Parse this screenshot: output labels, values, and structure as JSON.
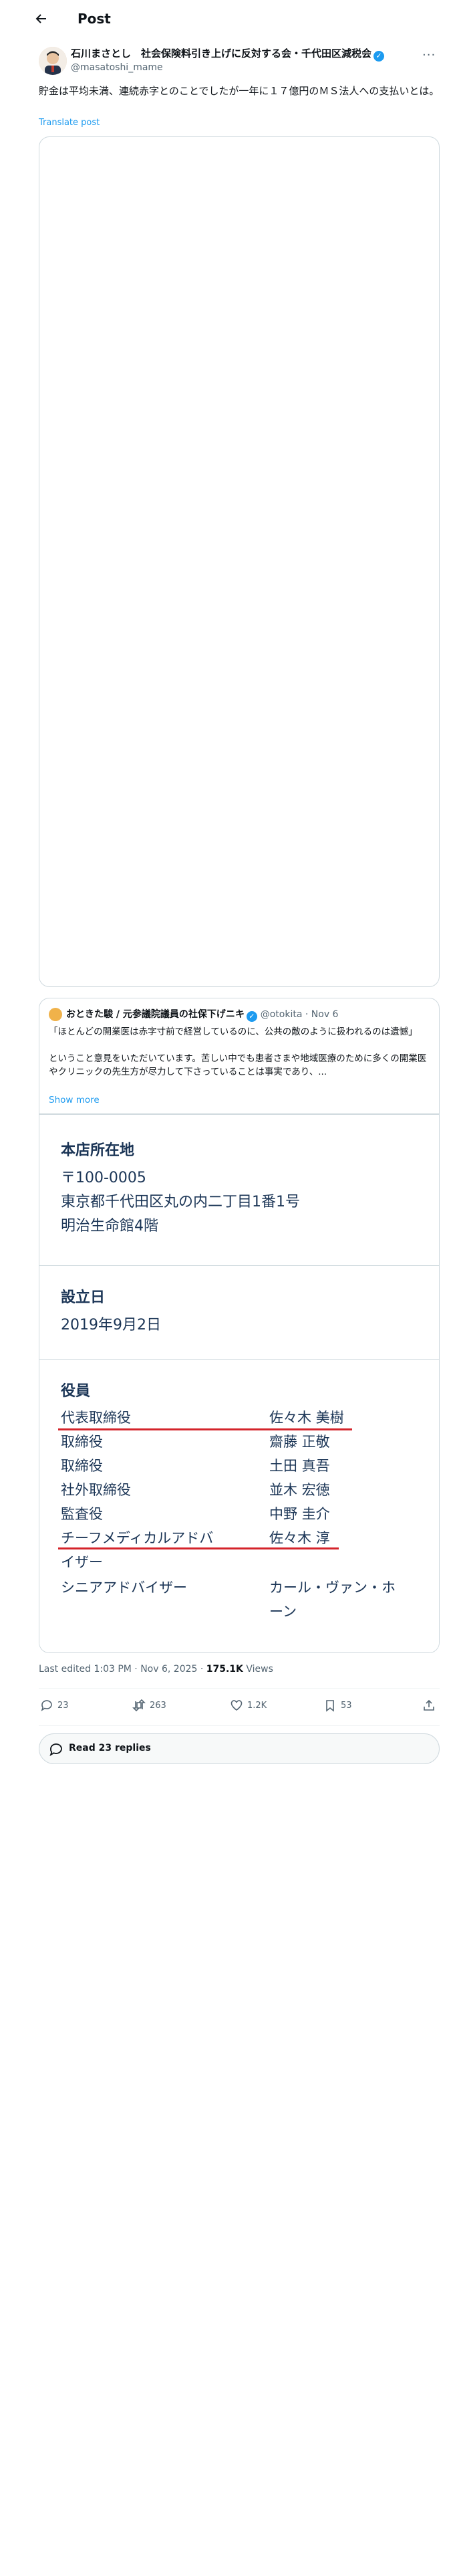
{
  "header": {
    "title": "Post"
  },
  "author": {
    "name": "石川まさとし　社会保険料引き上げに反対する会・千代田区減税会",
    "handle": "@masatoshi_mame"
  },
  "post": {
    "text": "貯金は平均未満、連続赤字とのことでしたが一年に１７億円のＭＳ法人への支払いとは。",
    "translate_label": "Translate post"
  },
  "quote": {
    "author_name": "おときた駿 / 元参議院議員の社保下げニキ",
    "author_handle": "@otokita · Nov 6",
    "text": "「ほとんどの開業医は赤字寸前で経営しているのに、公共の敵のように扱われるのは遺憾」\n\nということ意見をいただいています。苦しい中でも患者さまや地域医療のために多くの開業医やクリニックの先生方が尽力して下さっていることは事実であり、...",
    "show_more": "Show more",
    "image": {
      "address_heading": "本店所在地",
      "address": "〒100-0005\n東京都千代田区丸の内二丁目1番1号\n明治生命館4階",
      "founded_heading": "設立日",
      "founded": "2019年9月2日",
      "officers_heading": "役員",
      "officers": [
        {
          "role": "代表取締役",
          "name": "佐々木 美樹"
        },
        {
          "role": "取締役",
          "name": "齋藤 正敬"
        },
        {
          "role": "取締役",
          "name": "土田 真吾"
        },
        {
          "role": "社外取締役",
          "name": "並木 宏徳"
        },
        {
          "role": "監査役",
          "name": "中野 圭介"
        },
        {
          "role": "チーフメディカルアドバ",
          "name": "佐々木 淳"
        },
        {
          "role": "イザー",
          "name": ""
        },
        {
          "role": "シニアアドバイザー",
          "name": "カール・ヴァン・ホ"
        },
        {
          "role": "",
          "name": "ーン"
        }
      ]
    }
  },
  "meta": {
    "edited": "Last edited 1:03 PM · Nov 6, 2025 · ",
    "views_count": "175.1K",
    "views_label": " Views"
  },
  "actions": {
    "replies": "23",
    "reposts": "263",
    "likes": "1.2K",
    "bookmarks": "53"
  },
  "read_replies": "Read 23 replies",
  "colors": {
    "accent": "#1d9bf0",
    "underline": "#d4232a",
    "navy": "#1b3556"
  }
}
